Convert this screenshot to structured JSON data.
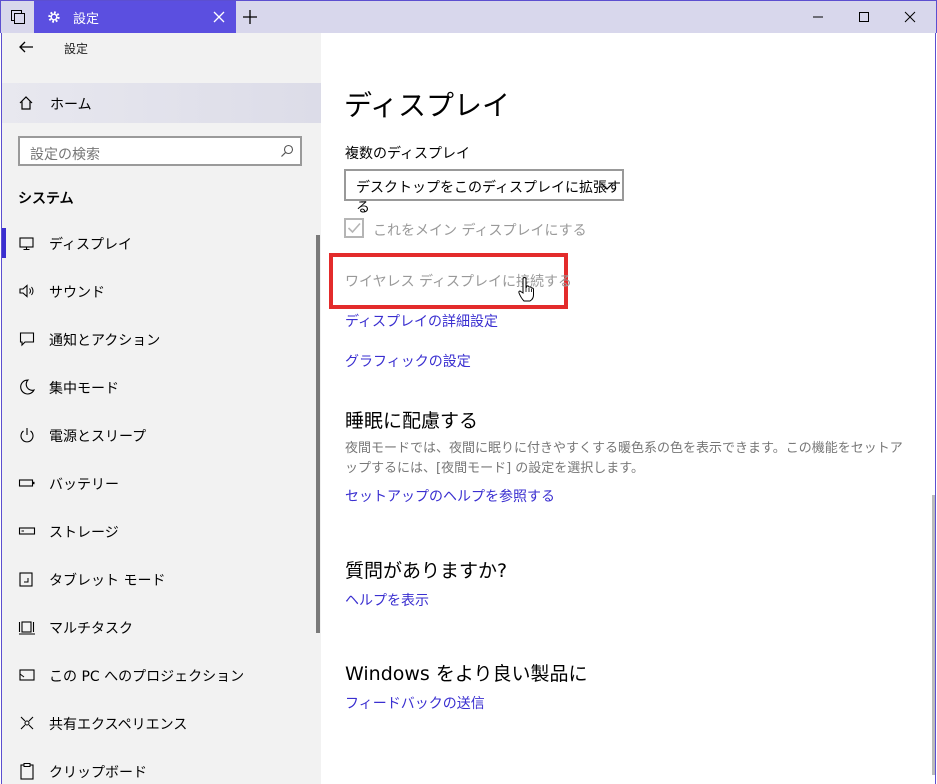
{
  "titlebar": {
    "tab_title": "設定"
  },
  "sidebar": {
    "title": "設定",
    "home_label": "ホーム",
    "search_placeholder": "設定の検索",
    "section_heading": "システム",
    "items": [
      {
        "label": "ディスプレイ",
        "icon": "monitor-icon",
        "active": true
      },
      {
        "label": "サウンド",
        "icon": "speaker-icon"
      },
      {
        "label": "通知とアクション",
        "icon": "notification-icon"
      },
      {
        "label": "集中モード",
        "icon": "moon-icon"
      },
      {
        "label": "電源とスリープ",
        "icon": "power-icon"
      },
      {
        "label": "バッテリー",
        "icon": "battery-icon"
      },
      {
        "label": "ストレージ",
        "icon": "storage-icon"
      },
      {
        "label": "タブレット モード",
        "icon": "tablet-icon"
      },
      {
        "label": "マルチタスク",
        "icon": "multitask-icon"
      },
      {
        "label": "この PC へのプロジェクション",
        "icon": "projection-icon"
      },
      {
        "label": "共有エクスペリエンス",
        "icon": "share-icon"
      },
      {
        "label": "クリップボード",
        "icon": "clipboard-icon"
      }
    ]
  },
  "main": {
    "page_title": "ディスプレイ",
    "multi_display_label": "複数のディスプレイ",
    "dropdown_value": "デスクトップをこのディスプレイに拡張する",
    "checkbox_label": "これをメイン ディスプレイにする",
    "wireless_link": "ワイヤレス ディスプレイに接続する",
    "advanced_link": "ディスプレイの詳細設定",
    "graphics_link": "グラフィックの設定",
    "sleep_heading": "睡眠に配慮する",
    "sleep_desc": "夜間モードでは、夜間に眠りに付きやすくする暖色系の色を表示できます。この機能をセットアップするには、[夜間モード] の設定を選択します。",
    "setup_help_link": "セットアップのヘルプを参照する",
    "question_heading": "質問がありますか?",
    "help_link": "ヘルプを表示",
    "better_heading": "Windows をより良い製品に",
    "feedback_link": "フィードバックの送信"
  }
}
